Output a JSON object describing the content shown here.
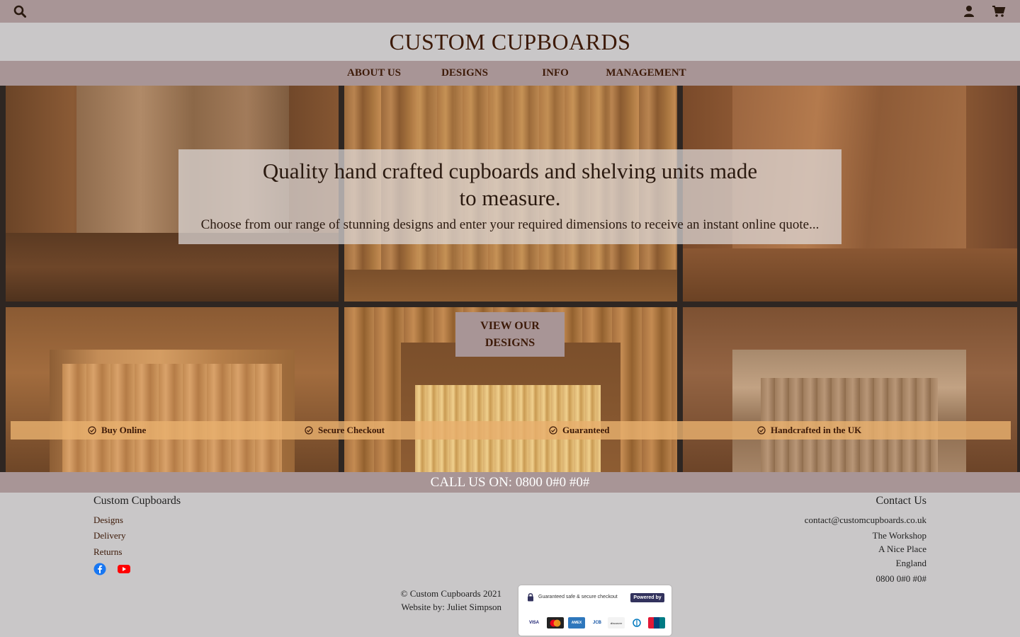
{
  "topbar": {
    "search_icon": "search-icon",
    "user_icon": "user-icon",
    "cart_icon": "cart-icon"
  },
  "brand": "CUSTOM CUPBOARDS",
  "nav": {
    "items": [
      {
        "label": "ABOUT US"
      },
      {
        "label": "DESIGNS"
      },
      {
        "label": "INFO"
      },
      {
        "label": "MANAGEMENT"
      }
    ]
  },
  "hero": {
    "headline": "Quality hand crafted cupboards and shelving units made to measure.",
    "subline": "Choose from our range of stunning designs and enter your required dimensions to receive an instant online quote...",
    "cta_label": "VIEW OUR DESIGNS",
    "features": [
      {
        "label": "Buy Online",
        "icon": "check-circle-icon"
      },
      {
        "label": "Secure Checkout",
        "icon": "check-circle-icon"
      },
      {
        "label": "Guaranteed",
        "icon": "check-circle-icon"
      },
      {
        "label": "Handcrafted in the UK",
        "icon": "check-circle-icon"
      }
    ]
  },
  "callbar": "CALL US ON: 0800 0#0 #0#",
  "footer": {
    "left_title": "Custom Cupboards",
    "links": [
      "Designs",
      "Delivery",
      "Returns"
    ],
    "social": [
      "facebook-icon",
      "youtube-icon"
    ],
    "right_title": "Contact Us",
    "email": "contact@customcupboards.co.uk",
    "address": [
      "The Workshop",
      "A Nice Place",
      "England"
    ],
    "phone": "0800 0#0 #0#",
    "copyright": "© Custom Cupboards 2021",
    "credit": "Website by: Juliet Simpson",
    "secure_badge": {
      "text": "Guaranteed safe & secure checkout",
      "powered_by": "Powered by stripe",
      "cards": [
        "VISA",
        "mastercard",
        "AMEX",
        "JCB",
        "discover",
        "diners",
        "UnionPay"
      ]
    }
  },
  "colors": {
    "bar": "#a89596",
    "background": "#c9c7c8",
    "brand_text": "#3d1a08",
    "feature_strip": "#e8b06e"
  }
}
